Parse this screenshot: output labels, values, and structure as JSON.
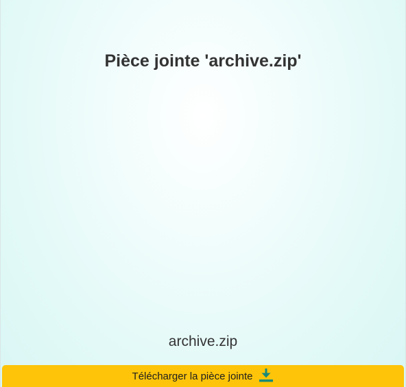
{
  "page": {
    "title": "Pièce jointe 'archive.zip'",
    "filename": "archive.zip"
  },
  "download": {
    "label": "Télécharger la pièce jointe",
    "icon": "download-icon",
    "color": "#fdc40a",
    "icon_color": "#1a8a78"
  }
}
